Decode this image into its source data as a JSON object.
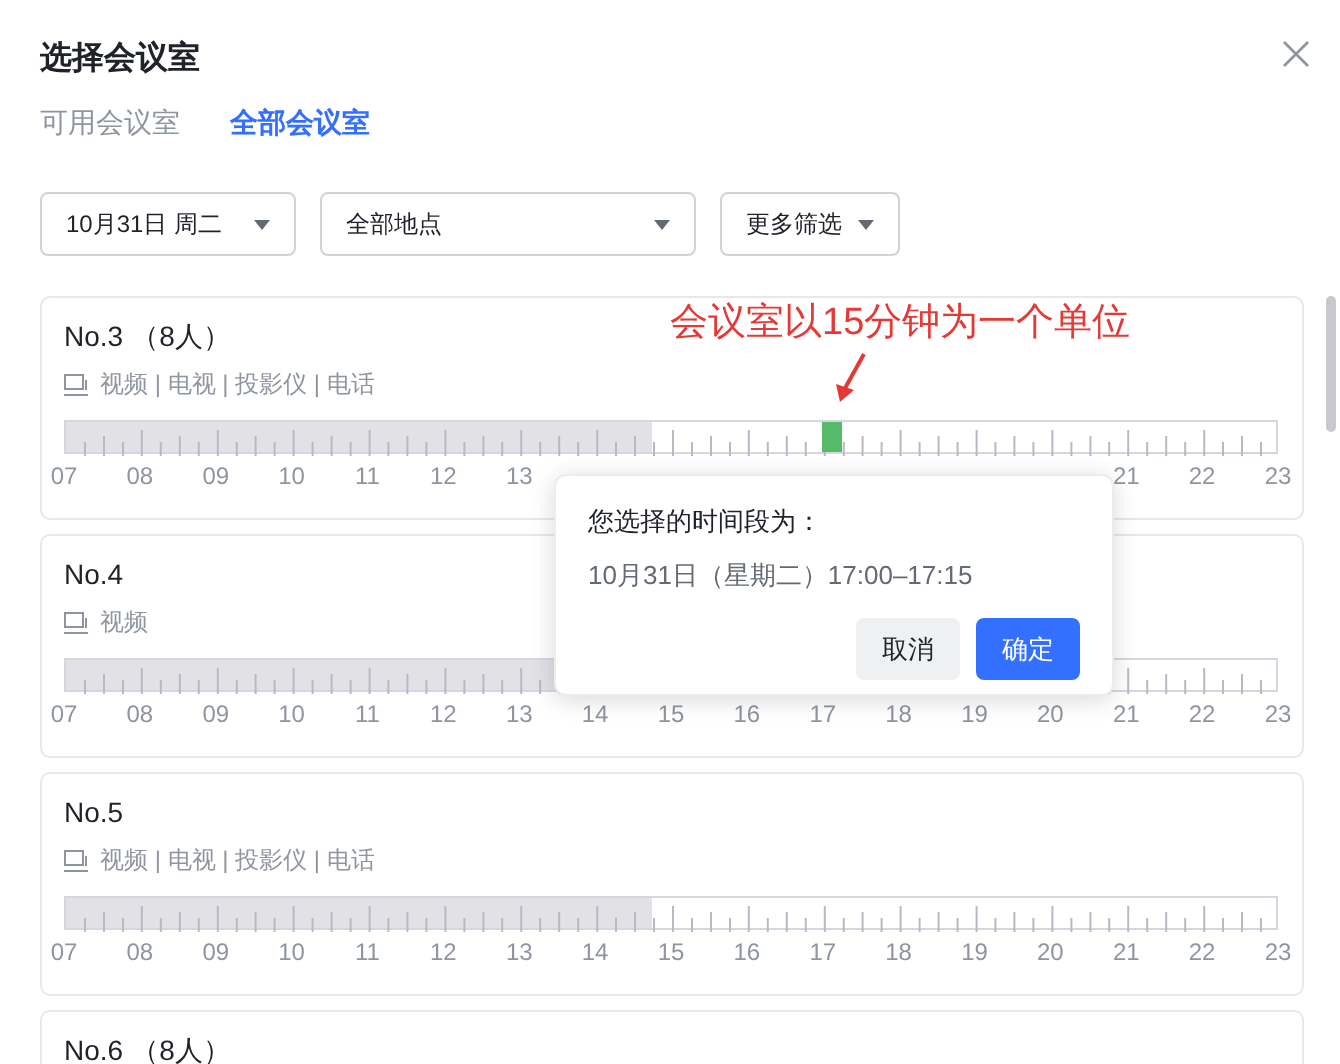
{
  "dialog": {
    "title": "选择会议室"
  },
  "tabs": [
    {
      "label": "可用会议室",
      "selected": false
    },
    {
      "label": "全部会议室",
      "selected": true
    }
  ],
  "filters": [
    {
      "label": "10月31日 周二"
    },
    {
      "label": "全部地点"
    },
    {
      "label": "更多筛选"
    }
  ],
  "rooms": [
    {
      "name": "No.3",
      "capacity": "（8人）",
      "equipment": "视频 | 电视 | 投影仪 | 电话",
      "timeline": {
        "level": 0.484375,
        "selected_slot": {
          "level": 0.625
        }
      },
      "hour_labels": [
        "07",
        "08",
        "09",
        "10",
        "11",
        "12",
        "13"
      ],
      "hour_labels_end": [
        "21",
        "22",
        "23"
      ]
    },
    {
      "name": "No.4",
      "equipment": "视频",
      "timeline": {
        "level": 0.484375
      },
      "hour_labels": [
        "07",
        "08",
        "09",
        "10",
        "11",
        "12",
        "13",
        "14",
        "15",
        "16",
        "17",
        "18",
        "19",
        "20",
        "21",
        "22",
        "23"
      ]
    },
    {
      "name": "No.5",
      "equipment": "视频 | 电视 | 投影仪 | 电话",
      "timeline": {
        "level": 0.484375
      },
      "hour_labels": [
        "07",
        "08",
        "09",
        "10",
        "11",
        "12",
        "13",
        "14",
        "15",
        "16",
        "17",
        "18",
        "19",
        "20",
        "21",
        "22",
        "23"
      ]
    },
    {
      "name": "No.6",
      "capacity": "（8人）"
    }
  ],
  "annotation": {
    "text": "会议室以15分钟为一个单位"
  },
  "popover": {
    "title": "您选择的时间段为：",
    "selection": "10月31日（星期二）17:00–17:15",
    "buttons": [
      {
        "label": "取消",
        "kind": "secondary"
      },
      {
        "label": "确定",
        "kind": "primary"
      }
    ]
  }
}
